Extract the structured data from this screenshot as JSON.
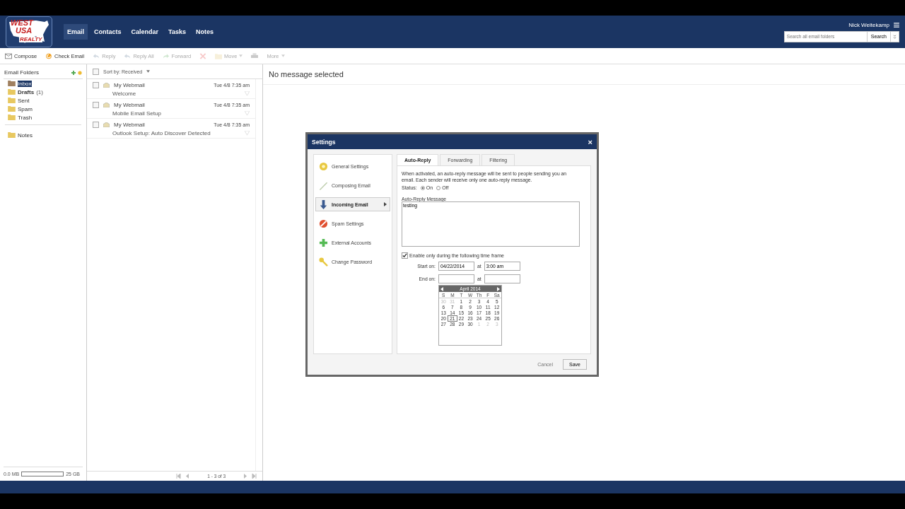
{
  "logo": {
    "line_1": "WEST",
    "line_2": "USA",
    "line_3": "REALTY"
  },
  "nav": [
    {
      "label": "Email",
      "selected": true
    },
    {
      "label": "Contacts",
      "selected": false
    },
    {
      "label": "Calendar",
      "selected": false
    },
    {
      "label": "Tasks",
      "selected": false
    },
    {
      "label": "Notes",
      "selected": false
    }
  ],
  "user": {
    "name": "Nick Weitekamp"
  },
  "search": {
    "placeholder": "Search all email folders",
    "button": "Search"
  },
  "toolbar": [
    {
      "label": "Compose",
      "disabled": false
    },
    {
      "label": "Check Email",
      "disabled": false
    },
    {
      "label": "Reply",
      "disabled": true
    },
    {
      "label": "Reply All",
      "disabled": true
    },
    {
      "label": "Forward",
      "disabled": true
    },
    {
      "disabled": true
    },
    {
      "label": "Move",
      "disabled": true
    },
    {
      "disabled": true
    },
    {
      "label": "More",
      "disabled": true
    }
  ],
  "folders": {
    "title": "Email Folders",
    "items": [
      {
        "name": "Inbox",
        "selected": true,
        "bold": false
      },
      {
        "name": "Drafts",
        "count": "(1)",
        "selected": false,
        "bold": true
      },
      {
        "name": "Sent",
        "selected": false,
        "bold": false
      },
      {
        "name": "Spam",
        "selected": false,
        "bold": false
      },
      {
        "name": "Trash",
        "selected": false,
        "bold": false
      }
    ],
    "extra": [
      {
        "name": "Notes"
      }
    ],
    "quota": {
      "used": "0.0 MB",
      "total": "25 GB"
    }
  },
  "messages": {
    "sort": "Sort by: Received",
    "all_checked": false,
    "items": [
      {
        "from": "My Webmail",
        "date": "Tue 4/8 7:35 am",
        "subject": "Welcome",
        "checked": false
      },
      {
        "from": "My Webmail",
        "date": "Tue 4/8 7:35 am",
        "subject": "Mobile Email Setup",
        "checked": false
      },
      {
        "from": "My Webmail",
        "date": "Tue 4/8 7:35 am",
        "subject": "Outlook Setup: Auto Discover Detected",
        "checked": false
      }
    ],
    "paging": "1 - 3 of 3"
  },
  "reading_pane": {
    "text": "No message selected"
  },
  "dialog": {
    "title": "Settings",
    "close": "×",
    "menu": [
      {
        "label": "General Settings",
        "selected": false
      },
      {
        "label": "Composing Email",
        "selected": false
      },
      {
        "label": "Incoming Email",
        "selected": true
      },
      {
        "label": "Spam Settings",
        "selected": false
      },
      {
        "label": "External Accounts",
        "selected": false
      },
      {
        "label": "Change Password",
        "selected": false
      }
    ],
    "tabs": [
      {
        "label": "Auto-Reply",
        "selected": true
      },
      {
        "label": "Forwarding",
        "selected": false
      },
      {
        "label": "Filtering",
        "selected": false
      }
    ],
    "description": "When activated, an auto-reply message will be sent to people sending you an email. Each sender will receive only one auto-reply message.",
    "status": {
      "label": "Status:",
      "options": [
        {
          "label": "On",
          "selected": true
        },
        {
          "label": "Off",
          "selected": false
        }
      ]
    },
    "message": {
      "label": "Auto-Reply Message",
      "value": "testing"
    },
    "timeframe": {
      "label": "Enable only during the following time frame",
      "checked": true
    },
    "start": {
      "label": "Start on:",
      "date": "04/22/2014",
      "at": "at",
      "time": "3:00 am"
    },
    "end": {
      "label": "End on:",
      "at": "at"
    },
    "calendar": {
      "month": "April 2014",
      "weekdays": [
        "S",
        "M",
        "T",
        "W",
        "Th",
        "F",
        "Sa"
      ],
      "days": [
        {
          "day": "30",
          "muted": true,
          "selected": false
        },
        {
          "day": "31",
          "muted": true,
          "selected": false
        },
        {
          "day": "1",
          "muted": false,
          "selected": false
        },
        {
          "day": "2",
          "muted": false,
          "selected": false
        },
        {
          "day": "3",
          "muted": false,
          "selected": false
        },
        {
          "day": "4",
          "muted": false,
          "selected": false
        },
        {
          "day": "5",
          "muted": false,
          "selected": false
        },
        {
          "day": "6",
          "muted": false,
          "selected": false
        },
        {
          "day": "7",
          "muted": false,
          "selected": false
        },
        {
          "day": "8",
          "muted": false,
          "selected": false
        },
        {
          "day": "9",
          "muted": false,
          "selected": false
        },
        {
          "day": "10",
          "muted": false,
          "selected": false
        },
        {
          "day": "11",
          "muted": false,
          "selected": false
        },
        {
          "day": "12",
          "muted": false,
          "selected": false
        },
        {
          "day": "13",
          "muted": false,
          "selected": false
        },
        {
          "day": "14",
          "muted": false,
          "selected": false
        },
        {
          "day": "15",
          "muted": false,
          "selected": false
        },
        {
          "day": "16",
          "muted": false,
          "selected": false
        },
        {
          "day": "17",
          "muted": false,
          "selected": false
        },
        {
          "day": "18",
          "muted": false,
          "selected": false
        },
        {
          "day": "19",
          "muted": false,
          "selected": false
        },
        {
          "day": "20",
          "muted": false,
          "selected": false
        },
        {
          "day": "21",
          "muted": false,
          "selected": true
        },
        {
          "day": "22",
          "muted": false,
          "selected": false
        },
        {
          "day": "23",
          "muted": false,
          "selected": false
        },
        {
          "day": "24",
          "muted": false,
          "selected": false
        },
        {
          "day": "25",
          "muted": false,
          "selected": false
        },
        {
          "day": "26",
          "muted": false,
          "selected": false
        },
        {
          "day": "27",
          "muted": false,
          "selected": false
        },
        {
          "day": "28",
          "muted": false,
          "selected": false
        },
        {
          "day": "29",
          "muted": false,
          "selected": false
        },
        {
          "day": "30",
          "muted": false,
          "selected": false
        },
        {
          "day": "1",
          "muted": true,
          "selected": false
        },
        {
          "day": "2",
          "muted": true,
          "selected": false
        },
        {
          "day": "3",
          "muted": true,
          "selected": false
        }
      ]
    },
    "buttons": [
      {
        "label": "Cancel",
        "kind": "link"
      },
      {
        "label": "Save",
        "kind": "button"
      }
    ]
  }
}
